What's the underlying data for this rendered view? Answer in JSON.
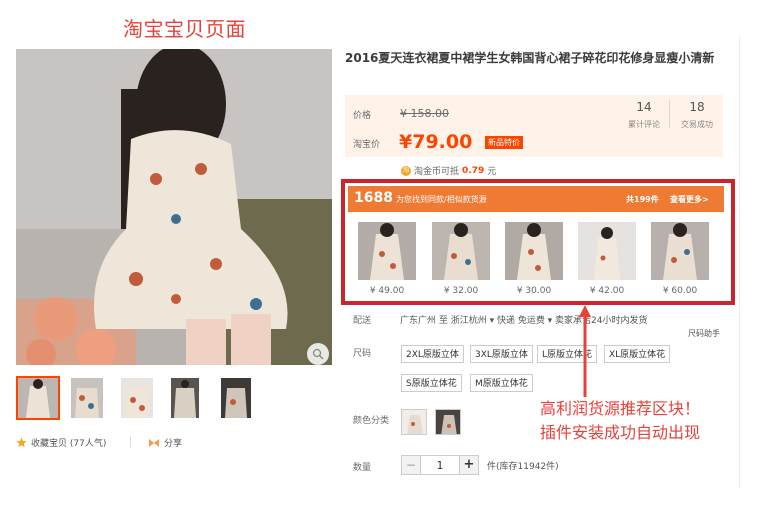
{
  "page_label": "淘宝宝贝页面",
  "product": {
    "title": "2016夏天连衣裙夏中裙学生女韩国背心裙子碎花印花修身显瘦小清新"
  },
  "price": {
    "original_label": "价格",
    "original_price": "¥ 158.00",
    "taobao_label": "淘宝价",
    "taobao_price": "¥79.00",
    "badge": "新品特价",
    "reviews_count": "14",
    "reviews_label": "累计评论",
    "sales_count": "18",
    "sales_label": "交易成功"
  },
  "coin": {
    "icon": "coin-icon",
    "text_prefix": "淘金币可抵",
    "amount": "0.79",
    "suffix": "元"
  },
  "source_1688": {
    "logo": "1688",
    "desc": "为您找到同款/相似款货源",
    "count": "共199件",
    "more": "查看更多>",
    "items": [
      {
        "price": "¥ 49.00"
      },
      {
        "price": "¥ 32.00"
      },
      {
        "price": "¥ 30.00"
      },
      {
        "price": "¥ 42.00"
      },
      {
        "price": "¥ 60.00"
      }
    ]
  },
  "shipping": {
    "label": "配送",
    "text": "广东广州 至  浙江杭州 ▾    快递 免运费 ▾    卖家承诺24小时内发货",
    "size_helper": "尺码助手"
  },
  "size": {
    "label": "尺码",
    "options": [
      "2XL原版立体",
      "3XL原版立体",
      "L原版立体花",
      "XL原版立体花",
      "S原版立体花",
      "M原版立体花"
    ]
  },
  "color": {
    "label": "颜色分类"
  },
  "quantity": {
    "label": "数量",
    "value": "1",
    "minus": "−",
    "plus": "+",
    "stock": "件(库存11942件)"
  },
  "gallery": {
    "collect": "收藏宝贝 (77人气)",
    "share": "分享"
  },
  "annotation": {
    "line1": "高利润货源推荐区块！",
    "line2": "插件安装成功自动出现"
  },
  "colors": {
    "accent": "#ff4400",
    "annotation_red": "#e8413a",
    "box_red": "#c9262c",
    "bar_orange": "#ef7a33",
    "price_bg": "#fff2e8"
  }
}
